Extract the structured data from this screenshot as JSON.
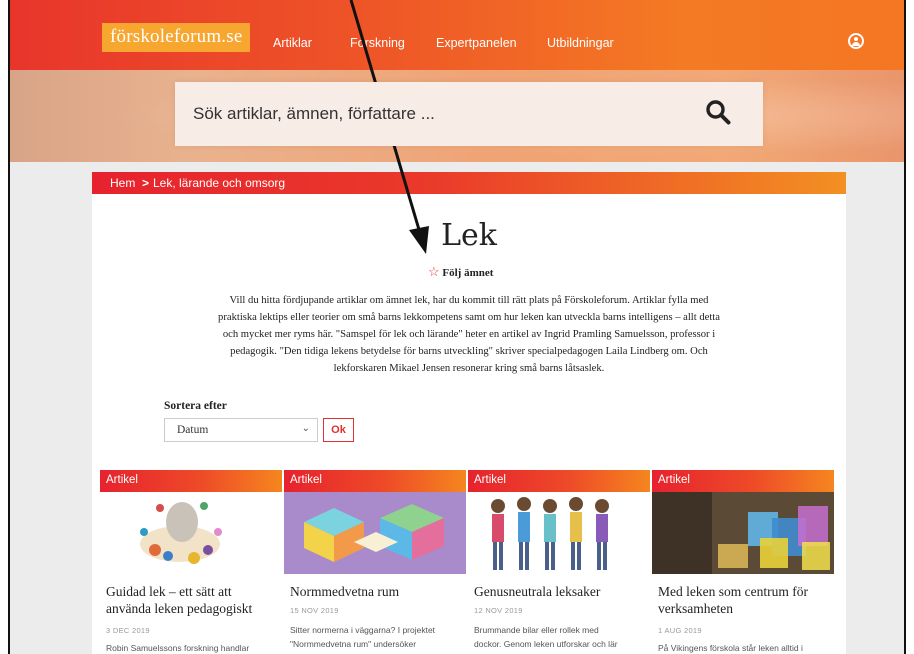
{
  "header": {
    "logo": "förskoleforum.se",
    "nav": [
      "Artiklar",
      "Forskning",
      "Expertpanelen",
      "Utbildningar"
    ],
    "user_icon": "user-circle-icon"
  },
  "search": {
    "placeholder": "Sök artiklar, ämnen, författare ...",
    "icon": "search-icon"
  },
  "breadcrumb": {
    "home": "Hem",
    "separator": ">",
    "current": "Lek, lärande och omsorg"
  },
  "page": {
    "title": "Lek",
    "follow_label": "Följ ämnet",
    "follow_icon": "star-outline-icon",
    "intro_lines": [
      "Vill du hitta fördjupande artiklar om ämnet lek, har du kommit till rätt plats på Förskoleforum. Artiklar fylla med",
      "praktiska lektips eller teorier om små barns lekkompetens samt om hur leken kan utveckla barns intelligens – allt detta",
      "och mycket mer ryms här. \"Samspel för lek och lärande\" heter en artikel av Ingrid Pramling Samuelsson, professor i",
      "pedagogik. \"Den tidiga lekens betydelse för barns utveckling\" skriver specialpedagogen Laila Lindberg om. Och",
      "lekforskaren Mikael Jensen resonerar kring små barns låtsaslek."
    ]
  },
  "sort": {
    "label": "Sortera efter",
    "selected": "Datum",
    "submit": "Ok"
  },
  "cards": [
    {
      "label": "Artikel",
      "title_lines": [
        "Guidad lek – ett sätt att",
        "använda leken pedagogiskt"
      ],
      "date": "3 DEC 2019",
      "text": "Robin Samuelssons forskning handlar"
    },
    {
      "label": "Artikel",
      "title_lines": [
        "Normmedvetna rum"
      ],
      "date": "15 NOV 2019",
      "text_lines": [
        "Sitter normerna i väggarna? I projektet",
        "\"Normmedvetna rum\" undersöker"
      ]
    },
    {
      "label": "Artikel",
      "title_lines": [
        "Genusneutrala leksaker"
      ],
      "date": "12 NOV 2019",
      "text_lines": [
        "Brummande bilar eller rollek med",
        "dockor. Genom leken utforskar och lär"
      ]
    },
    {
      "label": "Artikel",
      "title_lines": [
        "Med leken som centrum för",
        "verksamheten"
      ],
      "date": "1 AUG 2019",
      "text": "På Vikingens förskola står leken alltid i"
    }
  ]
}
